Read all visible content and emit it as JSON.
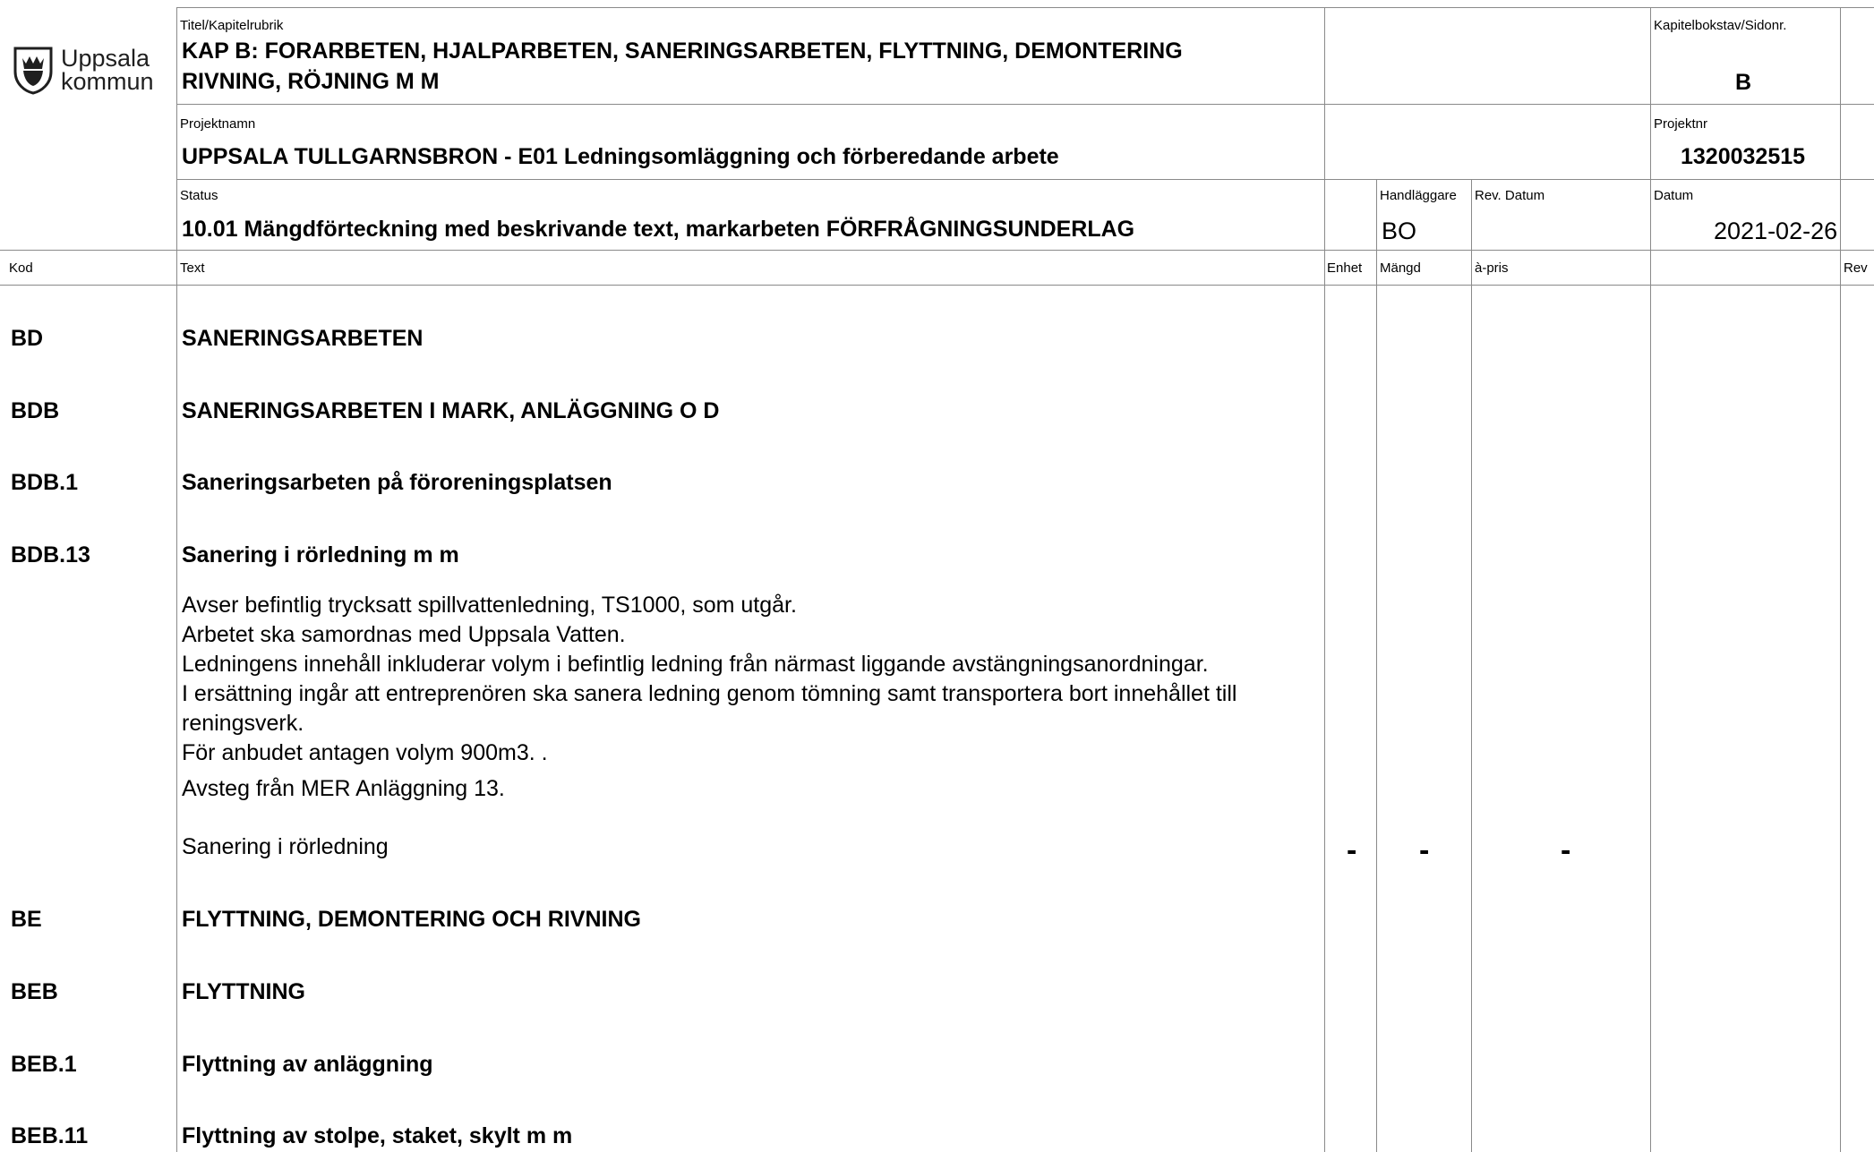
{
  "logo": {
    "line1": "Uppsala",
    "line2": "kommun"
  },
  "header": {
    "title_label": "Titel/Kapitelrubrik",
    "title_line1": "KAP B:   FORARBETEN, HJALPARBETEN, SANERINGSARBETEN, FLYTTNING, DEMONTERING",
    "title_line2": "RIVNING, RÖJNING M M",
    "chapter_label": "Kapitelbokstav/Sidonr.",
    "chapter_value": "B",
    "project_label": "Projektnamn",
    "project_value": "UPPSALA TULLGARNSBRON - E01  Ledningsomläggning och förberedande arbete",
    "projnr_label": "Projektnr",
    "projnr_value": "1320032515",
    "status_label": "Status",
    "status_value": "10.01 Mängdförteckning med beskrivande text, markarbeten  FÖRFRÅGNINGSUNDERLAG",
    "handlaggare_label": "Handläggare",
    "handlaggare_value": "BO",
    "revdatum_label": "Rev. Datum",
    "datum_label": "Datum",
    "datum_value": "2021-02-26"
  },
  "columns": {
    "kod": "Kod",
    "text": "Text",
    "enhet": "Enhet",
    "mangd": "Mängd",
    "apris": "à-pris",
    "rev": "Rev"
  },
  "rows": [
    {
      "code": "BD",
      "text": "SANERINGSARBETEN"
    },
    {
      "code": "BDB",
      "text": "SANERINGSARBETEN I MARK, ANLÄGGNING O D"
    },
    {
      "code": "BDB.1",
      "text": "Saneringsarbeten på föroreningsplatsen"
    },
    {
      "code": "BDB.13",
      "text": "Sanering i rörledning m m"
    },
    {
      "code": "BE",
      "text": "FLYTTNING, DEMONTERING OCH RIVNING"
    },
    {
      "code": "BEB",
      "text": "FLYTTNING"
    },
    {
      "code": "BEB.1",
      "text": "Flyttning av anläggning"
    },
    {
      "code": "BEB.11",
      "text": "Flyttning av stolpe, staket, skylt m m"
    }
  ],
  "description": [
    "Avser befintlig trycksatt spillvattenledning, TS1000, som utgår.",
    "Arbetet ska samordnas med Uppsala Vatten.",
    "Ledningens innehåll inkluderar volym i befintlig ledning från närmast liggande avstängningsanordningar.",
    "I ersättning ingår att entreprenören ska sanera ledning genom tömning samt transportera bort innehållet till",
    "reningsverk.",
    "För anbudet antagen volym 900m3. .",
    "Avsteg från MER Anläggning 13."
  ],
  "item": {
    "text": "Sanering i rörledning",
    "enhet": "-",
    "mangd": "-",
    "apris": "-"
  },
  "colors": {
    "grid": "#8a8a8a",
    "logo": "#1f1f1f"
  }
}
